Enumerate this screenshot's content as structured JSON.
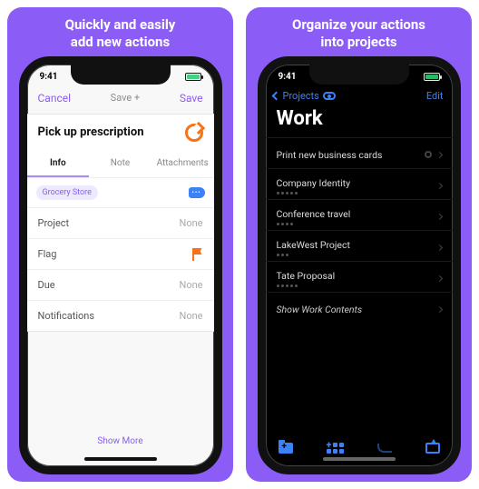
{
  "left": {
    "caption": "Quickly and easily\nadd new actions",
    "time": "9:41",
    "cancel": "Cancel",
    "savePlus": "Save +",
    "save": "Save",
    "itemTitle": "Pick up prescription",
    "tabs": {
      "info": "Info",
      "note": "Note",
      "attachments": "Attachments"
    },
    "tag": "Grocery Store",
    "fields": {
      "project": {
        "label": "Project",
        "value": "None"
      },
      "flag": {
        "label": "Flag"
      },
      "due": {
        "label": "Due",
        "value": "None"
      },
      "notifications": {
        "label": "Notifications",
        "value": "None"
      }
    },
    "showMore": "Show More"
  },
  "right": {
    "caption": "Organize your actions\ninto projects",
    "time": "9:41",
    "back": "Projects",
    "edit": "Edit",
    "title": "Work",
    "items": [
      {
        "label": "Print new business cards",
        "type": "action"
      },
      {
        "label": "Company Identity",
        "type": "project"
      },
      {
        "label": "Conference travel",
        "type": "project"
      },
      {
        "label": "LakeWest Project",
        "type": "project"
      },
      {
        "label": "Tate Proposal",
        "type": "project"
      }
    ],
    "showContents": "Show Work Contents"
  }
}
